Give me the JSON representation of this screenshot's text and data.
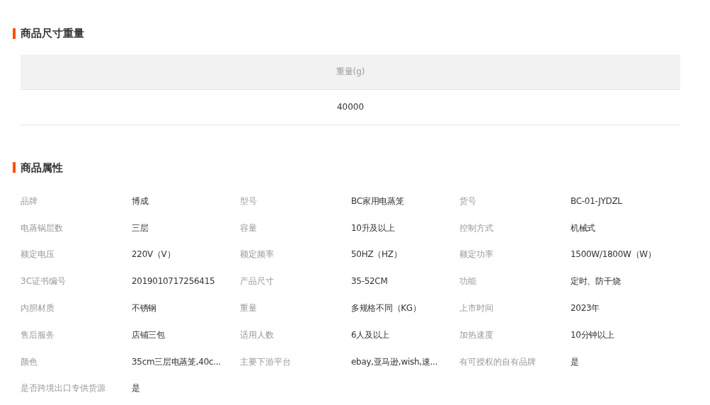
{
  "size_weight": {
    "title": "商品尺寸重量",
    "columns": [
      "重量(g)"
    ],
    "rows": [
      [
        "40000"
      ]
    ]
  },
  "attributes": {
    "title": "商品属性",
    "items": [
      {
        "name": "品牌",
        "value": "博成"
      },
      {
        "name": "型号",
        "value": "BC家用电蒸笼"
      },
      {
        "name": "货号",
        "value": "BC-01-JYDZL"
      },
      {
        "name": "电蒸锅层数",
        "value": "三层"
      },
      {
        "name": "容量",
        "value": "10升及以上"
      },
      {
        "name": "控制方式",
        "value": "机械式"
      },
      {
        "name": "额定电压",
        "value": "220V（V）"
      },
      {
        "name": "额定频率",
        "value": "50HZ（HZ）"
      },
      {
        "name": "额定功率",
        "value": "1500W/1800W（W）"
      },
      {
        "name": "3C证书编号",
        "value": "2019010717256415"
      },
      {
        "name": "产品尺寸",
        "value": "35-52CM"
      },
      {
        "name": "功能",
        "value": "定时、防干烧"
      },
      {
        "name": "内胆材质",
        "value": "不锈钢"
      },
      {
        "name": "重量",
        "value": "多规格不同（KG）"
      },
      {
        "name": "上市时间",
        "value": "2023年"
      },
      {
        "name": "售后服务",
        "value": "店铺三包"
      },
      {
        "name": "适用人数",
        "value": "6人及以上"
      },
      {
        "name": "加热速度",
        "value": "10分钟以上"
      },
      {
        "name": "颜色",
        "value": "35cm三层电蒸笼,40c..."
      },
      {
        "name": "主要下游平台",
        "value": "ebay,亚马逊,wish,速..."
      },
      {
        "name": "有可授权的自有品牌",
        "value": "是"
      },
      {
        "name": "是否跨境出口专供货源",
        "value": "是"
      }
    ]
  }
}
